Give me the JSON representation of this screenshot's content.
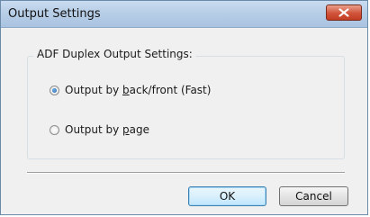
{
  "window": {
    "title": "Output Settings"
  },
  "group": {
    "label": "ADF Duplex Output Settings:"
  },
  "options": [
    {
      "pre": "Output by ",
      "key": "b",
      "post": "ack/front (Fast)",
      "checked": true
    },
    {
      "pre": "Output by ",
      "key": "p",
      "post": "age",
      "checked": false
    }
  ],
  "buttons": {
    "ok": "OK",
    "cancel": "Cancel"
  },
  "colors": {
    "dialog_bg": "#f0f0f0",
    "close_button": "#c23d22",
    "default_button_border": "#3c7fb1"
  },
  "icons": {
    "close": "close-icon"
  }
}
